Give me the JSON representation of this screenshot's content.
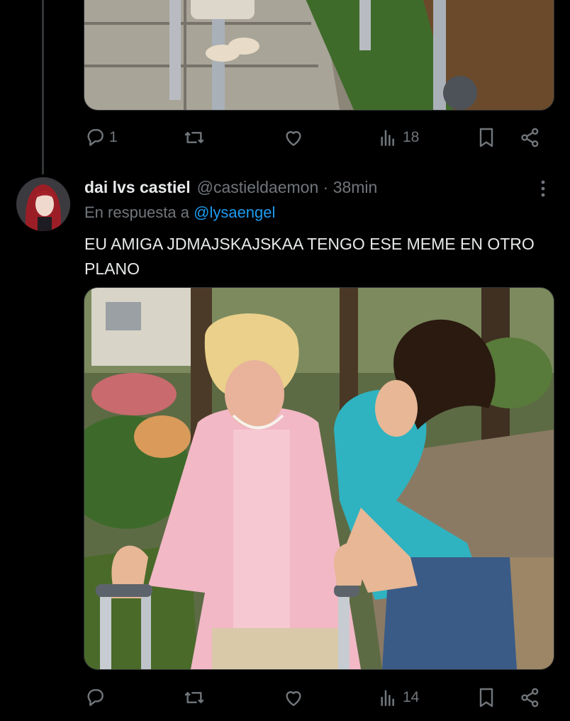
{
  "previous_tweet": {
    "stats": {
      "replies": "1",
      "retweets": "",
      "likes": "",
      "views": "18"
    }
  },
  "tweet": {
    "display_name": "dai lvs castiel",
    "handle_and_time": "@castieldaemon · 38min",
    "reply_prefix": "En respuesta a",
    "reply_to": "@lysaengel",
    "text": "EU AMIGA JDMAJSKAJSKAA TENGO ESE MEME EN OTRO PLANO",
    "stats": {
      "replies": "",
      "retweets": "",
      "likes": "",
      "views": "14"
    }
  },
  "icons": [
    "reply-icon",
    "retweet-icon",
    "like-icon",
    "views-icon",
    "bookmark-icon",
    "share-icon",
    "more-icon"
  ],
  "colors": {
    "background": "#000000",
    "text": "#e7e9ea",
    "muted": "#71767b",
    "link": "#1d9bf0"
  }
}
